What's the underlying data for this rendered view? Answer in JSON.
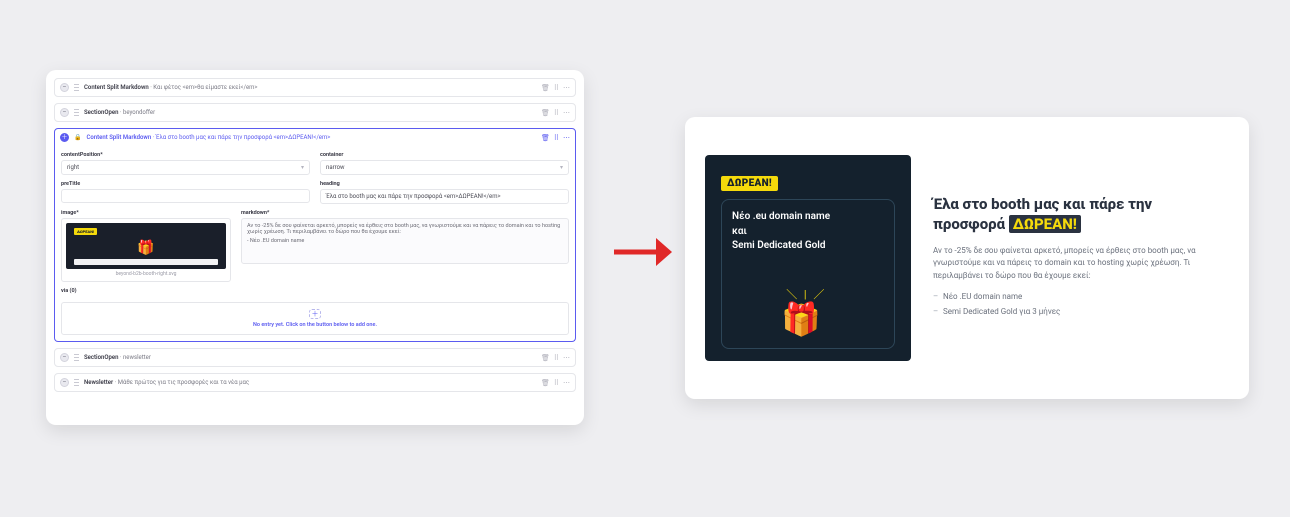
{
  "editor": {
    "blocks": [
      {
        "title": "Content Split Markdown",
        "desc": " · Και φέτος <em>θα είμαστε εκεί</em>"
      },
      {
        "title": "SectionOpen",
        "desc": " · beyondoffer"
      },
      {
        "title": "Content Split Markdown",
        "desc": " · Έλα στο booth μας και πάρε την προσφορά <em>ΔΩΡΕΑΝ!</em>"
      },
      {
        "title": "SectionOpen",
        "desc": " · newsletter"
      },
      {
        "title": "Newsletter",
        "desc": " · Μάθε πρώτος για τις προσφορές και τα νέα μας"
      }
    ],
    "fields": {
      "contentPosition": {
        "label": "contentPosition*",
        "value": "right"
      },
      "container": {
        "label": "container",
        "value": "narrow"
      },
      "preTitle": {
        "label": "preTitle",
        "value": ""
      },
      "heading": {
        "label": "heading",
        "value": "Έλα στο booth μας και πάρε την προσφορά <em>ΔΩΡΕΑΝ!</em>"
      },
      "image": {
        "label": "image*",
        "caption": "beyond-b2b-booth-right.svg"
      },
      "markdown": {
        "label": "markdown*",
        "line1": "Αν το -25% δε σου φαίνεται αρκετό, μπορείς να έρθεις στο booth μας, να γνωριστούμε και να πάρεις το domain και το hosting χωρίς χρέωση. Τι περιλαμβάνει το δώρο που θα έχουμε εκεί:",
        "line2": "- Νέο .EU domain name"
      },
      "via": {
        "label": "via (0)",
        "add_msg": "No entry yet. Click on the button below to add one."
      }
    },
    "icons": {
      "delete": "🗑",
      "drag": "⠿",
      "more": "⋯",
      "caret": "▾",
      "lock": "🔒",
      "plus": "＋",
      "collapse": "–"
    }
  },
  "preview": {
    "promo": {
      "badge": "ΔΩΡΕΑΝ!",
      "line1": "Νέο .eu domain name",
      "line2": "και",
      "line3": "Semi Dedicated Gold"
    },
    "heading_prefix": "Έλα στο booth μας και πάρε την προσφορά ",
    "heading_highlight": "ΔΩΡΕΑΝ!",
    "paragraph": "Αν το -25% δε σου φαίνεται αρκετό, μπορείς να έρθεις στο booth μας, να γνωριστούμε και να πάρεις το domain και το hosting χωρίς χρέωση. Τι περιλαμβάνει το δώρο που θα έχουμε εκεί:",
    "bullet1": "Νέο .EU domain name",
    "bullet2": "Semi Dedicated Gold για 3 μήνες"
  },
  "colors": {
    "accent": "#5b5bf0",
    "promo_bg": "#14212d",
    "highlight": "#f5da0b"
  }
}
